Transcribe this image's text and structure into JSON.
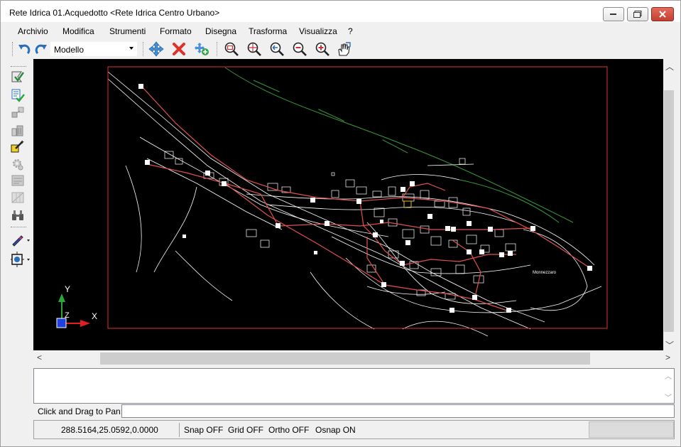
{
  "window": {
    "title": "Rete Idrica 01.Acquedotto <Rete Idrica Centro Urbano>"
  },
  "menu": [
    "Archivio",
    "Modifica",
    "Strumenti",
    "Formato",
    "Disegna",
    "Trasforma",
    "Visualizza",
    "?"
  ],
  "toolbar": {
    "view_combo_value": "Modello",
    "icons": [
      "undo-icon",
      "redo-icon",
      "move-icon",
      "delete-icon",
      "add-icon",
      "zoom-window-icon",
      "zoom-center-icon",
      "zoom-previous-icon",
      "zoom-out-icon",
      "zoom-in-icon",
      "pan-hand-icon"
    ]
  },
  "left_toolbar": {
    "icons": [
      "select-tool-icon",
      "checklist-icon",
      "move-node-icon",
      "buildings-icon",
      "magic-wand-icon",
      "gear-icon",
      "layers-icon",
      "grid-icon",
      "binoculars-icon",
      "pen-icon",
      "target-icon"
    ]
  },
  "canvas": {
    "place_label": "Monnezzaro",
    "axis_y_label": "Y",
    "axis_x_label": "X",
    "axis_z_label": "Z",
    "background": "#000000",
    "frame_color": "#e03030",
    "pipe_color": "#e05050",
    "street_color": "#ffffff",
    "contour_color": "#3a9a3a"
  },
  "command": {
    "prompt_label": "Click and Drag to Pan:",
    "input_value": ""
  },
  "status": {
    "coordinates": "288.5164,25.0592,0.0000",
    "snap": "Snap OFF",
    "grid": "Grid OFF",
    "ortho": "Ortho OFF",
    "osnap": "Osnap ON"
  }
}
